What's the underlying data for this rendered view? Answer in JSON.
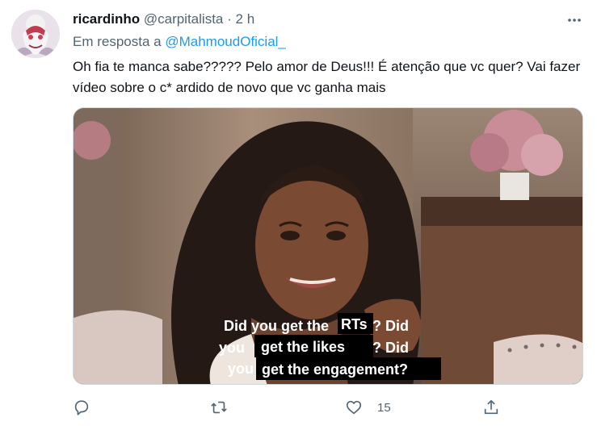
{
  "tweet": {
    "display_name": "ricardinho",
    "handle": "@carpitalista",
    "separator": "·",
    "time": "2 h",
    "reply_prefix": "Em resposta a",
    "reply_to": "@MahmoudOficial_",
    "text": "Oh fia te manca sabe????? Pelo amor de Deus!!! É atenção que vc quer? Vai fazer vídeo sobre o c* ardido de novo que vc ganha mais"
  },
  "media": {
    "caption_lines": [
      {
        "plain_before": "Did you get the ",
        "boxed": "RTs",
        "plain_after": "? Did"
      },
      {
        "plain_before": "you ",
        "boxed": "get the likes",
        "plain_after": " ? Did"
      },
      {
        "plain_before": "you ",
        "boxed": "get the engagement?",
        "plain_after": ""
      }
    ]
  },
  "actions": {
    "reply_icon": "reply-icon",
    "retweet_icon": "retweet-icon",
    "like_icon": "heart-icon",
    "like_count": "15",
    "share_icon": "share-icon"
  },
  "colors": {
    "accent": "#1d9bf0",
    "secondary_text": "#536471",
    "primary_text": "#0f1419"
  }
}
